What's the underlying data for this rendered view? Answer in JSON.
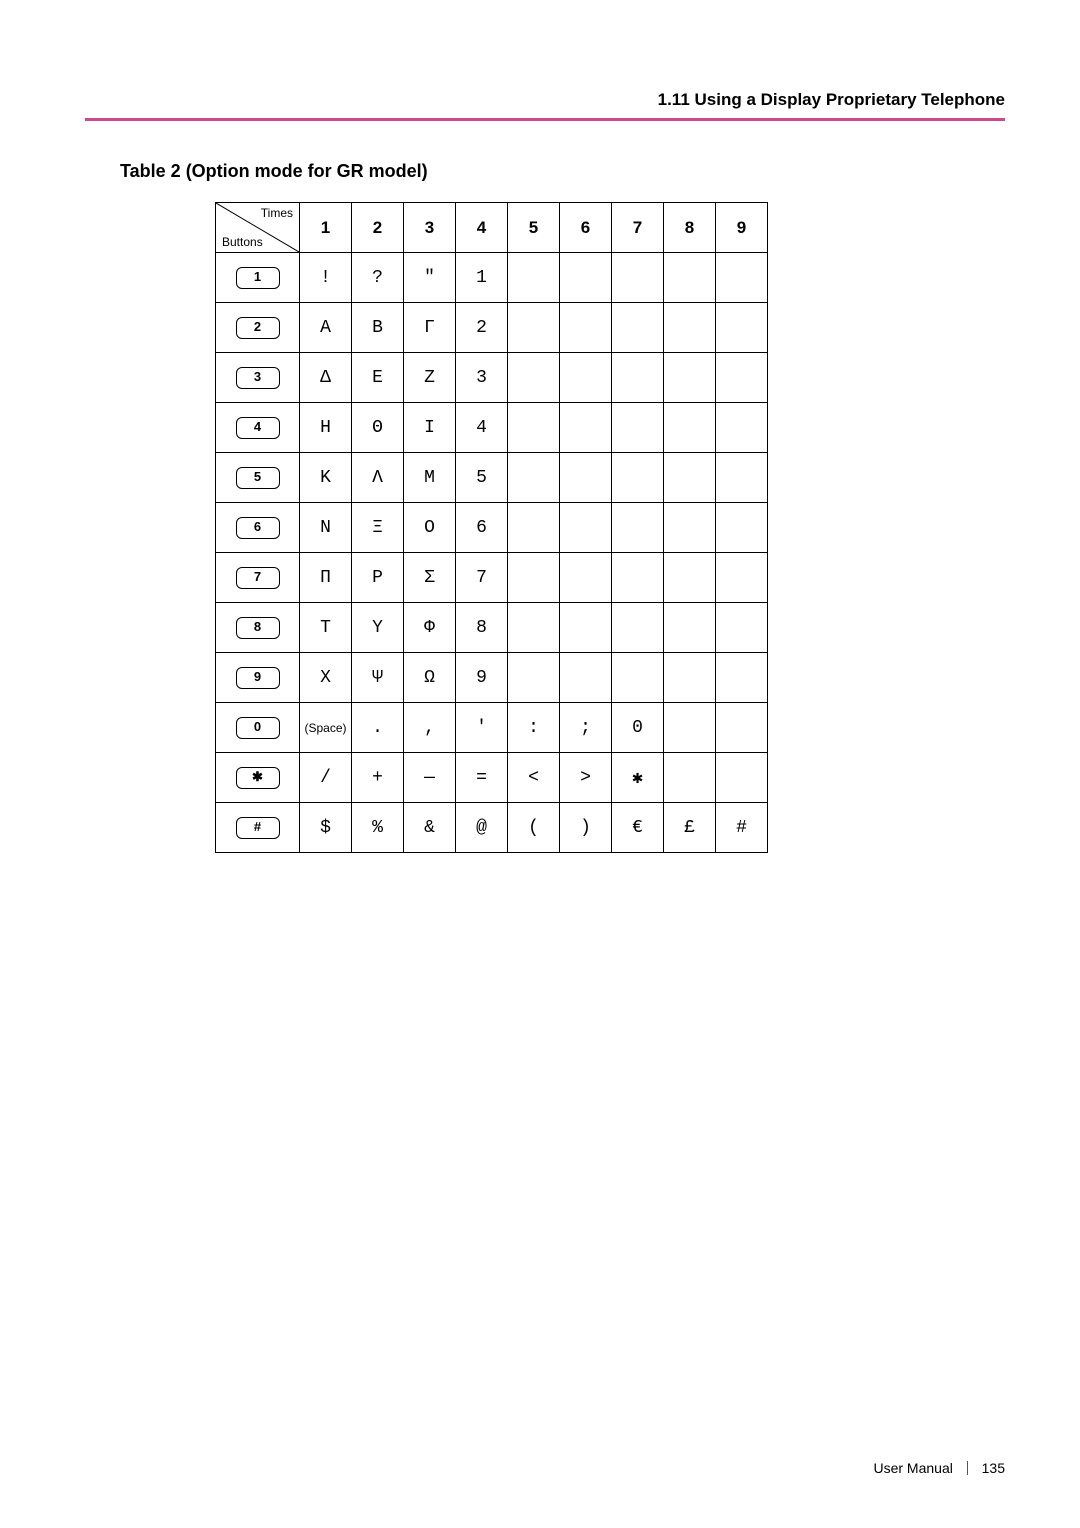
{
  "header": {
    "section": "1.11 Using a Display Proprietary Telephone"
  },
  "title": "Table 2 (Option mode for GR model)",
  "diag": {
    "top": "Times",
    "bottom": "Buttons"
  },
  "cols": [
    "1",
    "2",
    "3",
    "4",
    "5",
    "6",
    "7",
    "8",
    "9"
  ],
  "rows": [
    {
      "key": "1",
      "cells": [
        "!",
        "?",
        "\"",
        "1",
        "",
        "",
        "",
        "",
        ""
      ]
    },
    {
      "key": "2",
      "cells": [
        "Α",
        "Β",
        "Γ",
        "2",
        "",
        "",
        "",
        "",
        ""
      ]
    },
    {
      "key": "3",
      "cells": [
        "Δ",
        "Ε",
        "Ζ",
        "3",
        "",
        "",
        "",
        "",
        ""
      ]
    },
    {
      "key": "4",
      "cells": [
        "Η",
        "Θ",
        "Ι",
        "4",
        "",
        "",
        "",
        "",
        ""
      ]
    },
    {
      "key": "5",
      "cells": [
        "Κ",
        "Λ",
        "Μ",
        "5",
        "",
        "",
        "",
        "",
        ""
      ]
    },
    {
      "key": "6",
      "cells": [
        "Ν",
        "Ξ",
        "Ο",
        "6",
        "",
        "",
        "",
        "",
        ""
      ]
    },
    {
      "key": "7",
      "cells": [
        "Π",
        "Ρ",
        "Σ",
        "7",
        "",
        "",
        "",
        "",
        ""
      ]
    },
    {
      "key": "8",
      "cells": [
        "Τ",
        "Υ",
        "Φ",
        "8",
        "",
        "",
        "",
        "",
        ""
      ]
    },
    {
      "key": "9",
      "cells": [
        "Χ",
        "Ψ",
        "Ω",
        "9",
        "",
        "",
        "",
        "",
        ""
      ]
    },
    {
      "key": "0",
      "cells": [
        "(Space)",
        ".",
        ",",
        "'",
        ":",
        ";",
        "0",
        "",
        ""
      ]
    },
    {
      "key": "✱",
      "cells": [
        "/",
        "+",
        "—",
        "=",
        "<",
        ">",
        "✱",
        "",
        ""
      ]
    },
    {
      "key": "#",
      "cells": [
        "$",
        "%",
        "&",
        "@",
        "(",
        ")",
        "€",
        "£",
        "#"
      ]
    }
  ],
  "footer": {
    "label": "User Manual",
    "page": "135"
  }
}
